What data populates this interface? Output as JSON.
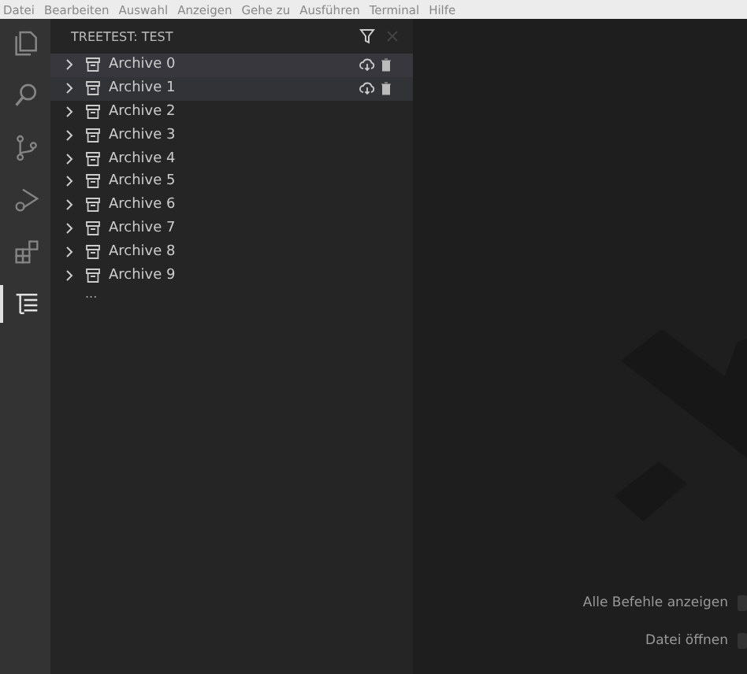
{
  "menu_bar": [
    "Datei",
    "Bearbeiten",
    "Auswahl",
    "Anzeigen",
    "Gehe zu",
    "Ausführen",
    "Terminal",
    "Hilfe"
  ],
  "activity_bar": [
    {
      "kind": "files",
      "selected": false
    },
    {
      "kind": "search",
      "selected": false
    },
    {
      "kind": "source-control",
      "selected": false
    },
    {
      "kind": "debug",
      "selected": false
    },
    {
      "kind": "extensions",
      "selected": false
    },
    {
      "kind": "tree",
      "selected": true
    }
  ],
  "sidebar": {
    "title": "TREETEST: TEST",
    "items": [
      {
        "label": "Archive 0",
        "selected": true,
        "hovered": false,
        "actions_visible": true
      },
      {
        "label": "Archive 1",
        "selected": false,
        "hovered": true,
        "actions_visible": true
      },
      {
        "label": "Archive 2",
        "selected": false,
        "hovered": false,
        "actions_visible": false
      },
      {
        "label": "Archive 3",
        "selected": false,
        "hovered": false,
        "actions_visible": false
      },
      {
        "label": "Archive 4",
        "selected": false,
        "hovered": false,
        "actions_visible": false
      },
      {
        "label": "Archive 5",
        "selected": false,
        "hovered": false,
        "actions_visible": false
      },
      {
        "label": "Archive 6",
        "selected": false,
        "hovered": false,
        "actions_visible": false
      },
      {
        "label": "Archive 7",
        "selected": false,
        "hovered": false,
        "actions_visible": false
      },
      {
        "label": "Archive 8",
        "selected": false,
        "hovered": false,
        "actions_visible": false
      },
      {
        "label": "Archive 9",
        "selected": false,
        "hovered": false,
        "actions_visible": false
      }
    ],
    "more": "..."
  },
  "editor": {
    "hints": [
      "Alle Befehle anzeigen",
      "Datei öffnen"
    ]
  }
}
